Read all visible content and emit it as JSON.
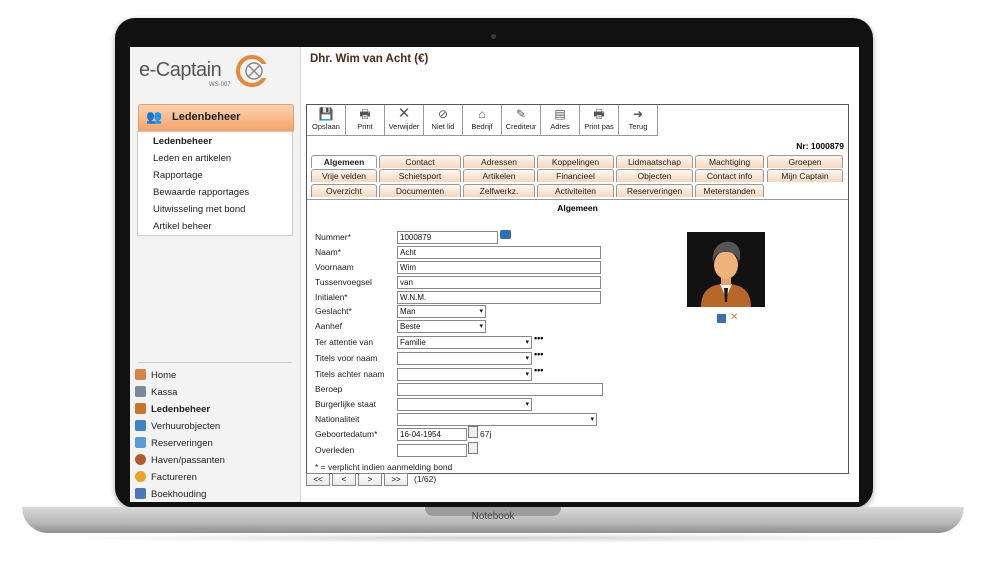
{
  "device": {
    "label": "Notebook"
  },
  "logo": {
    "name": "e-Captain",
    "sub": "WS-007"
  },
  "sidebar": {
    "section_title": "Ledenbeheer",
    "menu": [
      "Ledenbeheer",
      "Leden en artikelen",
      "Rapportage",
      "Bewaarde rapportages",
      "Uitwisseling met bond",
      "Artikel beheer"
    ],
    "nav": [
      "Home",
      "Kassa",
      "Ledenbeheer",
      "Verhuurobjecten",
      "Reserveringen",
      "Haven/passanten",
      "Factureren",
      "Boekhouding"
    ]
  },
  "page": {
    "title": "Dhr. Wim van Acht (€)",
    "nr": "Nr: 1000879",
    "section": "Algemeen"
  },
  "toolbar": [
    "Opslaan",
    "Print",
    "Verwijder",
    "Niet lid",
    "Bedrijf",
    "Crediteur",
    "Adres",
    "Print pas",
    "Terug"
  ],
  "tabs": {
    "row1": [
      "Algemeen",
      "Contact",
      "Adressen",
      "Koppelingen",
      "Lidmaatschap",
      "Machtiging",
      "Groepen"
    ],
    "row2": [
      "Vrije velden",
      "Schietsport",
      "Artikelen",
      "Financieel",
      "Objecten",
      "Contact info",
      "Mijn Captain"
    ],
    "row3": [
      "Overzicht",
      "Documenten",
      "Zelfwerkz.",
      "Activiteiten",
      "Reserveringen",
      "Meterstanden"
    ]
  },
  "form": {
    "nummer_label": "Nummer*",
    "nummer": "1000879",
    "naam_label": "Naam*",
    "naam": "Acht",
    "voornaam_label": "Voornaam",
    "voornaam": "Wim",
    "tussenvoegsel_label": "Tussenvoegsel",
    "tussenvoegsel": "van",
    "initialen_label": "Initialen*",
    "initialen": "W.N.M.",
    "geslacht_label": "Geslacht*",
    "geslacht": "Man",
    "aanhef_label": "Aanhef",
    "aanhef": "Beste",
    "attentie_label": "Ter attentie van",
    "attentie": "Familie",
    "titels_voor_label": "Titels voor naam",
    "titels_voor": "",
    "titels_achter_label": "Titels achter naam",
    "titels_achter": "",
    "beroep_label": "Beroep",
    "beroep": "",
    "burgerlijke_label": "Burgerlijke staat",
    "burgerlijke": "",
    "nationaliteit_label": "Nationaliteit",
    "nationaliteit": "",
    "geboortedatum_label": "Geboortedatum*",
    "geboortedatum": "16-04-1954",
    "leeftijd": "67j",
    "overleden_label": "Overleden",
    "overleden": "",
    "note": "* = verplicht indien aanmelding bond",
    "dots": "•••"
  },
  "pager": {
    "first": "<<",
    "prev": "<",
    "next": ">",
    "last": ">>",
    "position": "(1/62)"
  }
}
